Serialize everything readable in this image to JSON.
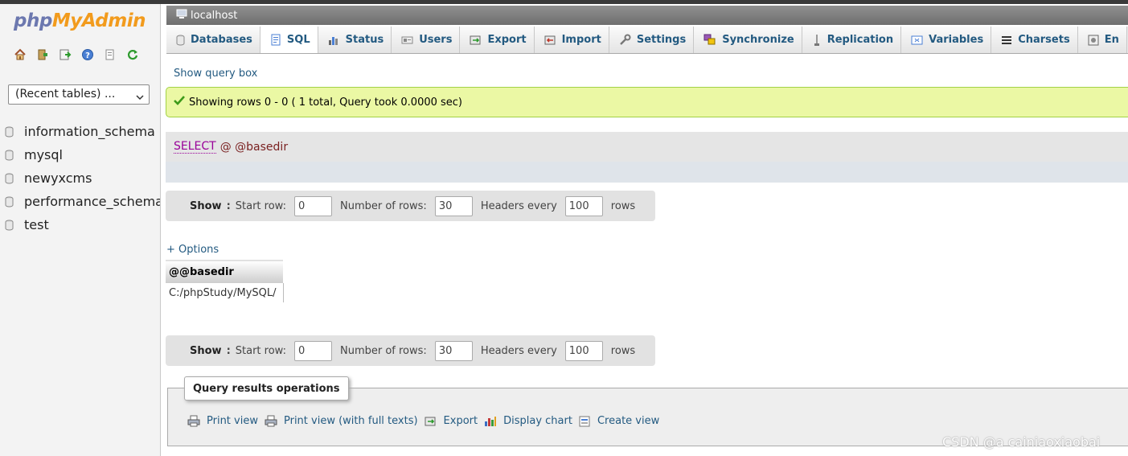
{
  "sidebar": {
    "logo_php": "php",
    "logo_myadmin": "MyAdmin",
    "nav_icons": [
      "home-icon",
      "logout-icon",
      "query-window-icon",
      "documentation-icon",
      "docs-page-icon",
      "reload-icon"
    ],
    "recent_tables": "(Recent tables) ...",
    "databases": [
      "information_schema",
      "mysql",
      "newyxcms",
      "performance_schema",
      "test"
    ]
  },
  "breadcrumb": {
    "server": "localhost"
  },
  "tabs": [
    {
      "label": "Databases",
      "icon": "database-icon"
    },
    {
      "label": "SQL",
      "icon": "sql-icon",
      "active": true
    },
    {
      "label": "Status",
      "icon": "status-icon"
    },
    {
      "label": "Users",
      "icon": "users-icon"
    },
    {
      "label": "Export",
      "icon": "export-icon"
    },
    {
      "label": "Import",
      "icon": "import-icon"
    },
    {
      "label": "Settings",
      "icon": "settings-icon"
    },
    {
      "label": "Synchronize",
      "icon": "synchronize-icon"
    },
    {
      "label": "Replication",
      "icon": "replication-icon"
    },
    {
      "label": "Variables",
      "icon": "variables-icon"
    },
    {
      "label": "Charsets",
      "icon": "charsets-icon"
    },
    {
      "label": "En",
      "icon": "engines-icon"
    }
  ],
  "main": {
    "show_query_box": "Show query box",
    "success_message": "Showing rows 0 - 0 ( 1 total, Query took 0.0000 sec)",
    "sql_keyword": "SELECT",
    "sql_rest": "@ @basedir",
    "options_link": "+ Options",
    "result_header": "@@basedir",
    "result_value": "C:/phpStudy/MySQL/"
  },
  "navigation": {
    "show_label": "Show",
    "start_row_label": "Start row:",
    "start_row": "0",
    "num_rows_label": "Number of rows:",
    "num_rows": "30",
    "headers_every_label": "Headers every",
    "headers_every": "100",
    "rows_label": "rows"
  },
  "operations": {
    "legend": "Query results operations",
    "links": [
      {
        "label": "Print view",
        "icon": "print-icon"
      },
      {
        "label": "Print view (with full texts)",
        "icon": "print-icon"
      },
      {
        "label": "Export",
        "icon": "export-icon"
      },
      {
        "label": "Display chart",
        "icon": "chart-icon"
      },
      {
        "label": "Create view",
        "icon": "view-icon"
      }
    ]
  },
  "watermark": "CSDN @a cainiaoxiaobai",
  "colors": {
    "link": "#235a81",
    "logo_php": "#6c78af",
    "logo_myadmin": "#f29b1d",
    "success_bg": "#ebf8a4",
    "success_border": "#a2d246",
    "sql_keyword": "#990099"
  }
}
